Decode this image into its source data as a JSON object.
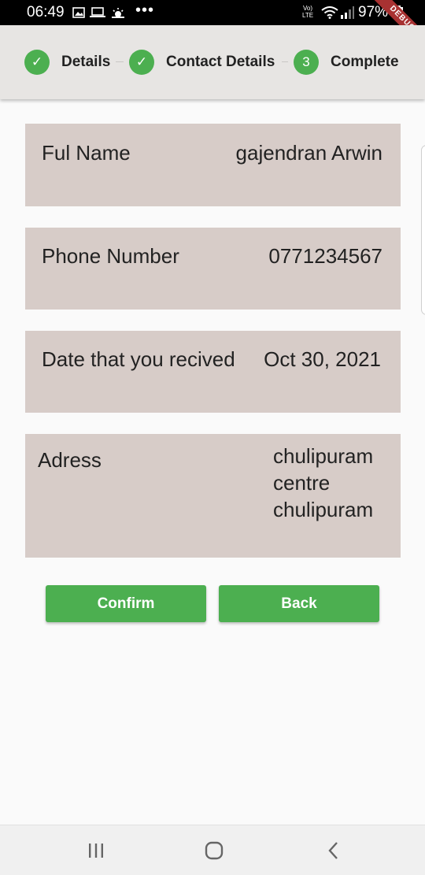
{
  "status_bar": {
    "time": "06:49",
    "dots": "•••",
    "volte": "Vo)\nLTE",
    "battery": "97%",
    "debug": "DEBUG"
  },
  "stepper": {
    "steps": [
      {
        "label": "Details",
        "state": "complete",
        "marker": "✓"
      },
      {
        "label": "Contact Details",
        "state": "complete",
        "marker": "✓"
      },
      {
        "label": "Complete",
        "state": "active",
        "marker": "3"
      }
    ]
  },
  "details": {
    "full_name": {
      "label": "Ful Name",
      "value": "gajendran Arwin"
    },
    "phone": {
      "label": "Phone Number",
      "value": "0771234567"
    },
    "date": {
      "label": "Date that you recived",
      "value": "Oct 30, 2021"
    },
    "address": {
      "label": "Adress",
      "value": "chulipuram\ncentre\nchulipuram"
    }
  },
  "buttons": {
    "confirm": "Confirm",
    "back": "Back"
  },
  "colors": {
    "accent": "#4caf50",
    "card": "#d7ccc8",
    "header": "#e7e5e3"
  },
  "nav": {
    "recents_icon": "recents-icon",
    "home_icon": "home-icon",
    "back_icon": "back-icon"
  }
}
